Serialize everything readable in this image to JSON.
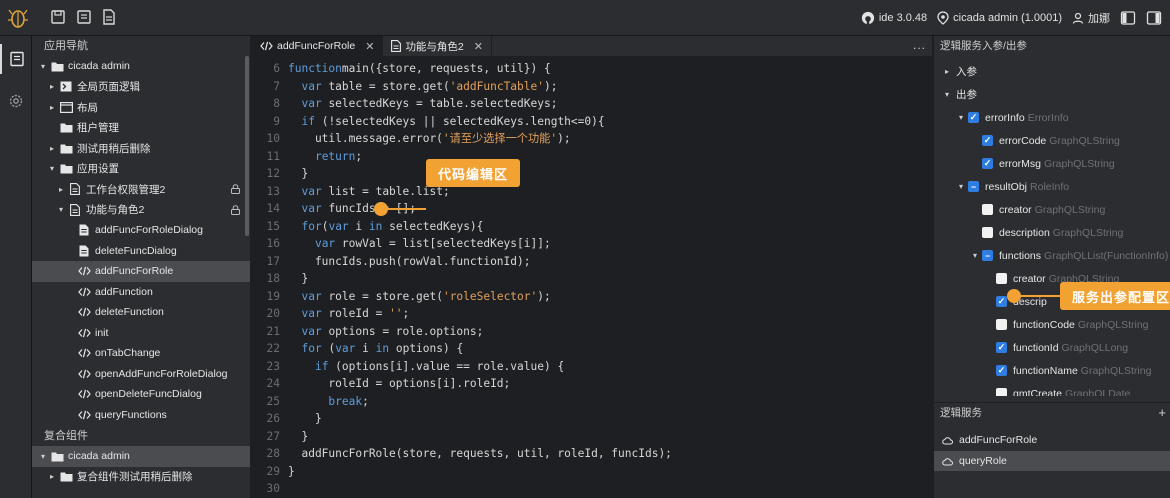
{
  "topbar": {
    "github_label": "ide 3.0.48",
    "location_label": "cicada admin (1.0001)",
    "user_label": "加娜"
  },
  "sidebar": {
    "nav_title": "应用导航",
    "nav_items": [
      {
        "label": "cicada admin",
        "level": 0,
        "chev": "▾",
        "icon": "folder-icon"
      },
      {
        "label": "全局页面逻辑",
        "level": 1,
        "chev": "▸",
        "icon": "terminal-icon"
      },
      {
        "label": "布局",
        "level": 1,
        "chev": "▸",
        "icon": "window-icon"
      },
      {
        "label": "租户管理",
        "level": 1,
        "chev": "",
        "icon": "folder-icon"
      },
      {
        "label": "测试用稍后删除",
        "level": 1,
        "chev": "▸",
        "icon": "folder-icon"
      },
      {
        "label": "应用设置",
        "level": 1,
        "chev": "▾",
        "icon": "folder-icon"
      },
      {
        "label": "工作台权限管理2",
        "level": 2,
        "chev": "▸",
        "icon": "file-icon",
        "lock": true
      },
      {
        "label": "功能与角色2",
        "level": 2,
        "chev": "▾",
        "icon": "file-icon",
        "lock": true
      },
      {
        "label": "addFuncForRoleDialog",
        "level": 3,
        "chev": "",
        "icon": "doc-icon"
      },
      {
        "label": "deleteFuncDialog",
        "level": 3,
        "chev": "",
        "icon": "doc-icon"
      },
      {
        "label": "addFuncForRole",
        "level": 3,
        "chev": "",
        "icon": "code-icon",
        "selected": true
      },
      {
        "label": "addFunction",
        "level": 3,
        "chev": "",
        "icon": "code-icon"
      },
      {
        "label": "deleteFunction",
        "level": 3,
        "chev": "",
        "icon": "code-icon"
      },
      {
        "label": "init",
        "level": 3,
        "chev": "",
        "icon": "code-icon"
      },
      {
        "label": "onTabChange",
        "level": 3,
        "chev": "",
        "icon": "code-icon"
      },
      {
        "label": "openAddFuncForRoleDialog",
        "level": 3,
        "chev": "",
        "icon": "code-icon"
      },
      {
        "label": "openDeleteFuncDialog",
        "level": 3,
        "chev": "",
        "icon": "code-icon"
      },
      {
        "label": "queryFunctions",
        "level": 3,
        "chev": "",
        "icon": "code-icon"
      }
    ],
    "composite_title": "复合组件",
    "composite_items": [
      {
        "label": "cicada admin",
        "level": 0,
        "chev": "▾",
        "icon": "folder-icon",
        "selected": true
      },
      {
        "label": "复合组件测试用稍后删除",
        "level": 1,
        "chev": "▸",
        "icon": "folder-icon"
      }
    ]
  },
  "editor": {
    "tabs": [
      {
        "label": "addFuncForRole",
        "icon": "code-icon",
        "active": true
      },
      {
        "label": "功能与角色2",
        "icon": "file-icon",
        "active": false
      }
    ],
    "more": "...",
    "lines": [
      {
        "n": "6",
        "parts": [
          [
            "kw",
            "function"
          ],
          [
            "",
            "main({store, requests, util}) {"
          ]
        ]
      },
      {
        "n": "7",
        "parts": [
          [
            "",
            "  "
          ],
          [
            "kw",
            "var"
          ],
          [
            "",
            " table = store.get("
          ],
          [
            "st",
            "'addFuncTable'"
          ],
          [
            "",
            ");"
          ]
        ]
      },
      {
        "n": "8",
        "parts": [
          [
            "",
            "  "
          ],
          [
            "kw",
            "var"
          ],
          [
            "",
            " selectedKeys = table.selectedKeys;"
          ]
        ]
      },
      {
        "n": "9",
        "parts": [
          [
            "",
            "  "
          ],
          [
            "kw",
            "if"
          ],
          [
            "",
            " (!selectedKeys || selectedKeys.length<=0){"
          ]
        ]
      },
      {
        "n": "10",
        "parts": [
          [
            "",
            "    util.message.error("
          ],
          [
            "st",
            "'请至少选择一个功能'"
          ],
          [
            "",
            ");"
          ]
        ]
      },
      {
        "n": "11",
        "parts": [
          [
            "",
            "    "
          ],
          [
            "kw",
            "return"
          ],
          [
            "",
            ";"
          ]
        ]
      },
      {
        "n": "12",
        "parts": [
          [
            "",
            "  }"
          ]
        ]
      },
      {
        "n": "13",
        "parts": [
          [
            "",
            "  "
          ],
          [
            "kw",
            "var"
          ],
          [
            "",
            " list = table.list;"
          ]
        ]
      },
      {
        "n": "14",
        "parts": [
          [
            "",
            "  "
          ],
          [
            "kw",
            "var"
          ],
          [
            "",
            " funcIds = [];"
          ]
        ]
      },
      {
        "n": "15",
        "parts": [
          [
            "",
            "  "
          ],
          [
            "kw",
            "for"
          ],
          [
            "",
            "("
          ],
          [
            "kw",
            "var"
          ],
          [
            "",
            " i "
          ],
          [
            "kw",
            "in"
          ],
          [
            "",
            " selectedKeys){"
          ]
        ]
      },
      {
        "n": "16",
        "parts": [
          [
            "",
            "    "
          ],
          [
            "kw",
            "var"
          ],
          [
            "",
            " rowVal = list[selectedKeys[i]];"
          ]
        ]
      },
      {
        "n": "17",
        "parts": [
          [
            "",
            "    funcIds.push(rowVal.functionId);"
          ]
        ]
      },
      {
        "n": "18",
        "parts": [
          [
            "",
            "  }"
          ]
        ]
      },
      {
        "n": "19",
        "parts": [
          [
            "",
            "  "
          ],
          [
            "kw",
            "var"
          ],
          [
            "",
            " role = store.get("
          ],
          [
            "st",
            "'roleSelector'"
          ],
          [
            "",
            ");"
          ]
        ]
      },
      {
        "n": "20",
        "parts": [
          [
            "",
            "  "
          ],
          [
            "kw",
            "var"
          ],
          [
            "",
            " roleId = "
          ],
          [
            "st",
            "''"
          ],
          [
            "",
            ";"
          ]
        ]
      },
      {
        "n": "21",
        "parts": [
          [
            "",
            "  "
          ],
          [
            "kw",
            "var"
          ],
          [
            "",
            " options = role.options;"
          ]
        ]
      },
      {
        "n": "22",
        "parts": [
          [
            "",
            "  "
          ],
          [
            "kw",
            "for"
          ],
          [
            "",
            " ("
          ],
          [
            "kw",
            "var"
          ],
          [
            "",
            " i "
          ],
          [
            "kw",
            "in"
          ],
          [
            "",
            " options) {"
          ]
        ]
      },
      {
        "n": "23",
        "parts": [
          [
            "",
            "    "
          ],
          [
            "kw",
            "if"
          ],
          [
            "",
            " (options[i].value == role.value) {"
          ]
        ]
      },
      {
        "n": "24",
        "parts": [
          [
            "",
            "      roleId = options[i].roleId;"
          ]
        ]
      },
      {
        "n": "25",
        "parts": [
          [
            "",
            "      "
          ],
          [
            "kw",
            "break"
          ],
          [
            "",
            ";"
          ]
        ]
      },
      {
        "n": "26",
        "parts": [
          [
            "",
            "    }"
          ]
        ]
      },
      {
        "n": "27",
        "parts": [
          [
            "",
            "  }"
          ]
        ]
      },
      {
        "n": "28",
        "parts": [
          [
            "",
            "  addFuncForRole(store, requests, util, roleId, funcIds);"
          ]
        ]
      },
      {
        "n": "29",
        "parts": [
          [
            "",
            "}"
          ]
        ]
      },
      {
        "n": "30",
        "parts": [
          [
            "",
            ""
          ]
        ]
      }
    ],
    "callout_label": "代码编辑区"
  },
  "right_panel": {
    "title": "逻辑服务入参/出参",
    "params": [
      {
        "label": "入参",
        "level": 0,
        "chev": "▸",
        "cb": "",
        "type": ""
      },
      {
        "label": "出参",
        "level": 0,
        "chev": "▾",
        "cb": "",
        "type": ""
      },
      {
        "label": "errorInfo",
        "level": 1,
        "chev": "▾",
        "cb": "checked",
        "type": "ErrorInfo"
      },
      {
        "label": "errorCode",
        "level": 2,
        "chev": "",
        "cb": "checked",
        "type": "GraphQLString"
      },
      {
        "label": "errorMsg",
        "level": 2,
        "chev": "",
        "cb": "checked",
        "type": "GraphQLString"
      },
      {
        "label": "resultObj",
        "level": 1,
        "chev": "▾",
        "cb": "partial",
        "type": "RoleInfo"
      },
      {
        "label": "creator",
        "level": 2,
        "chev": "",
        "cb": "empty",
        "type": "GraphQLString"
      },
      {
        "label": "description",
        "level": 2,
        "chev": "",
        "cb": "empty",
        "type": "GraphQLString"
      },
      {
        "label": "functions",
        "level": 2,
        "chev": "▾",
        "cb": "partial",
        "type": "GraphQLList(FunctionInfo)"
      },
      {
        "label": "creator",
        "level": 3,
        "chev": "",
        "cb": "empty",
        "type": "GraphQLString"
      },
      {
        "label": "descrip",
        "level": 3,
        "chev": "",
        "cb": "checked",
        "type": ""
      },
      {
        "label": "functionCode",
        "level": 3,
        "chev": "",
        "cb": "empty",
        "type": "GraphQLString"
      },
      {
        "label": "functionId",
        "level": 3,
        "chev": "",
        "cb": "checked",
        "type": "GraphQLLong"
      },
      {
        "label": "functionName",
        "level": 3,
        "chev": "",
        "cb": "checked",
        "type": "GraphQLString"
      },
      {
        "label": "gmtCreate",
        "level": 3,
        "chev": "",
        "cb": "empty",
        "type": "GraphQLDate"
      }
    ],
    "callout_label": "服务出参配置区",
    "services_title": "逻辑服务",
    "services_add": "+",
    "services": [
      {
        "label": "addFuncForRole",
        "selected": false
      },
      {
        "label": "queryRole",
        "selected": true
      }
    ]
  },
  "colors": {
    "accent": "#f2a233",
    "keyword": "#5f9ddb",
    "string": "#e2a05b",
    "checkbox": "#2f7de1"
  }
}
